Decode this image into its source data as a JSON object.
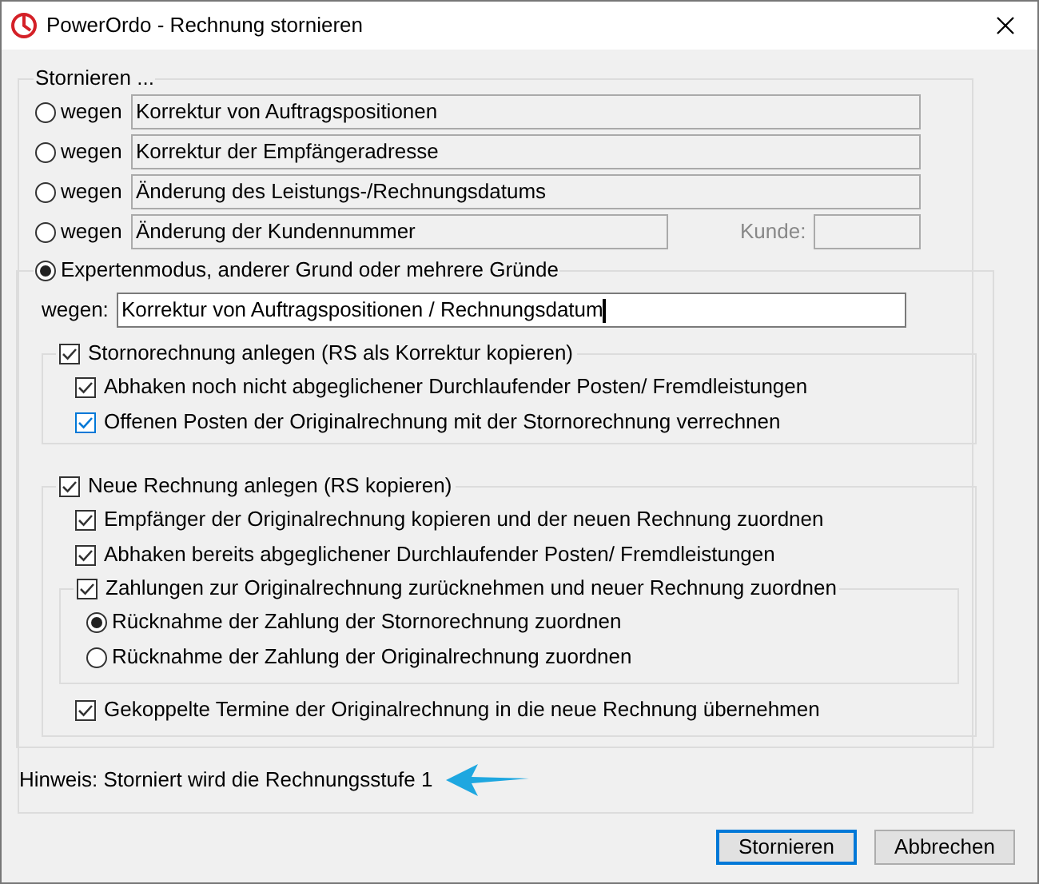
{
  "window": {
    "title": "PowerOrdo - Rechnung stornieren"
  },
  "group": {
    "label": "Stornieren ..."
  },
  "reasons": [
    {
      "label": "wegen",
      "value": "Korrektur von Auftragspositionen",
      "selected": false,
      "kind": "plain"
    },
    {
      "label": "wegen",
      "value": "Korrektur der Empfängeradresse",
      "selected": false,
      "kind": "plain"
    },
    {
      "label": "wegen",
      "value": "Änderung des Leistungs-/Rechnungsdatums",
      "selected": false,
      "kind": "plain"
    },
    {
      "label": "wegen",
      "value": "Änderung der Kundennummer",
      "selected": false,
      "kind": "customer",
      "extra_label": "Kunde:"
    }
  ],
  "expert": {
    "label": "Expertenmodus, anderer Grund oder mehrere Gründe",
    "selected": true,
    "field_label": "wegen:",
    "value": "Korrektur von Auftragspositionen / Rechnungsdatum"
  },
  "storno_group": {
    "label": "Stornorechnung anlegen (RS als Korrektur kopieren)",
    "checked": true,
    "options": [
      {
        "label": "Abhaken noch nicht abgeglichener Durchlaufender Posten/ Fremdleistungen",
        "checked": true,
        "color": "#333333"
      },
      {
        "label": "Offenen Posten der Originalrechnung mit der Stornorechnung verrechnen",
        "checked": true,
        "color": "#0078d7"
      }
    ]
  },
  "new_invoice_group": {
    "label": "Neue Rechnung anlegen (RS kopieren)",
    "checked": true,
    "options": [
      {
        "kind": "checkbox",
        "label": "Empfänger der Originalrechnung kopieren und der neuen Rechnung zuordnen",
        "checked": true
      },
      {
        "kind": "checkbox",
        "label": "Abhaken bereits abgeglichener Durchlaufender Posten/ Fremdleistungen",
        "checked": true
      },
      {
        "kind": "group",
        "label": "Zahlungen zur Originalrechnung zurücknehmen und neuer Rechnung zuordnen",
        "checked": true,
        "radios": [
          {
            "label": "Rücknahme der Zahlung der Stornorechnung zuordnen",
            "selected": true
          },
          {
            "label": "Rücknahme der Zahlung der Originalrechnung zuordnen",
            "selected": false
          }
        ]
      },
      {
        "kind": "checkbox",
        "label": "Gekoppelte Termine der Originalrechnung in die neue Rechnung übernehmen",
        "checked": true
      }
    ]
  },
  "hint": "Hinweis: Storniert wird die Rechnungsstufe 1",
  "buttons": [
    {
      "label": "Stornieren",
      "default": true
    },
    {
      "label": "Abbrechen",
      "default": false
    }
  ]
}
